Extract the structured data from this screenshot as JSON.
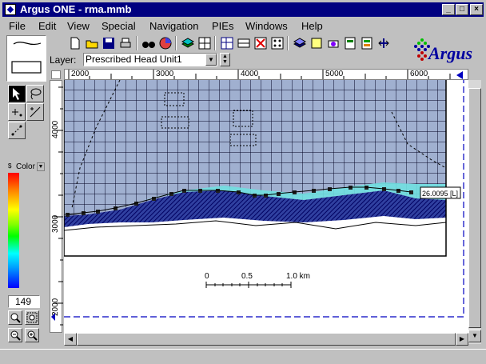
{
  "window": {
    "title": "Argus ONE - rma.mmb",
    "minimize_label": "_",
    "maximize_label": "□",
    "close_label": "×"
  },
  "menu": {
    "items": [
      "File",
      "Edit",
      "View",
      "Special",
      "Navigation",
      "PIEs",
      "Windows",
      "Help"
    ]
  },
  "logo": {
    "text": "Argus"
  },
  "layer": {
    "label": "Layer:",
    "selected": "Prescribed Head Unit1"
  },
  "color_panel": {
    "label": "Color",
    "value": "149"
  },
  "colors": {
    "title_bar": "#000080",
    "hatch_fill": "#000080",
    "mesh_fill": "#9fb0d0",
    "cyan_band": "#70e0e0",
    "selection_dash": "#0000c0"
  },
  "rulers": {
    "horizontal": [
      "2000",
      "3000",
      "4000",
      "5000",
      "6000"
    ],
    "vertical": [
      "4000",
      "3000",
      "2000"
    ]
  },
  "map": {
    "head_label": "26.0095 [L]",
    "scale_labels": [
      "0",
      "0.5",
      "1.0 km"
    ]
  }
}
